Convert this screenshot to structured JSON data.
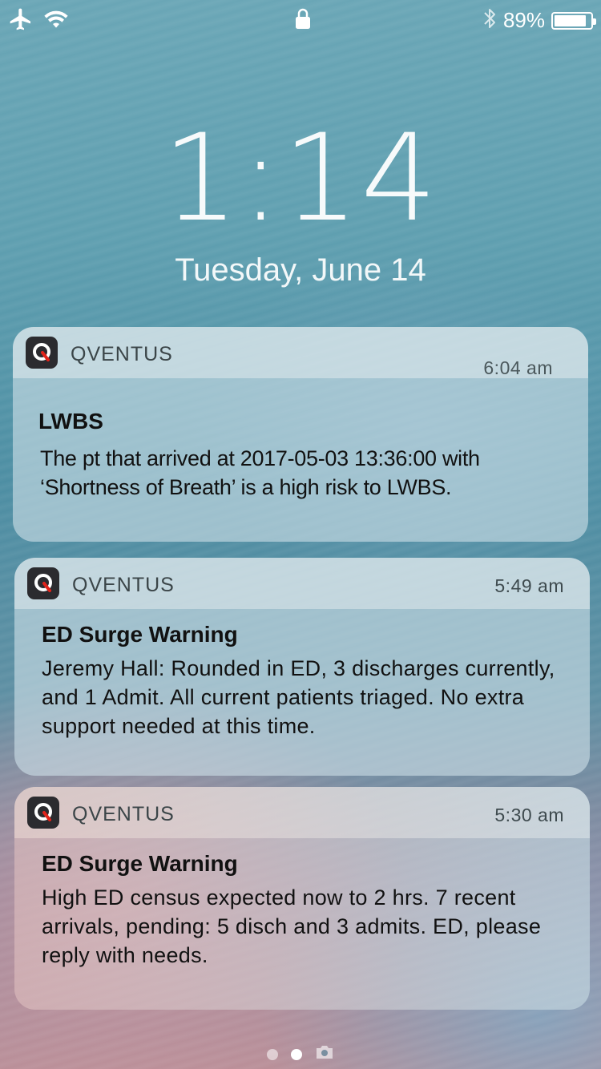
{
  "status_bar": {
    "left_icons": [
      "airplane-icon",
      "wifi-icon"
    ],
    "center_icon": "lock-icon",
    "right_icons": [
      "bluetooth-icon",
      "battery-icon"
    ],
    "battery_percent_text": "89%",
    "battery_level": 0.89
  },
  "lock_screen": {
    "time": "1:14",
    "date": "Tuesday, June 14"
  },
  "notifications": [
    {
      "app_name": "QVENTUS",
      "time": "6:04 am",
      "title": "LWBS",
      "message": "The pt that arrived at 2017-05-03 13:36:00 with ‘Shortness of Breath’ is a high risk to LWBS."
    },
    {
      "app_name": "QVENTUS",
      "time": "5:49 am",
      "title": "ED Surge Warning",
      "message": "Jeremy Hall: Rounded in ED, 3 discharges currently, and 1 Admit. All current patients triaged. No extra support needed at this time."
    },
    {
      "app_name": "QVENTUS",
      "time": "5:30 am",
      "title": "ED Surge Warning",
      "message": "High ED census expected now to 2 hrs. 7 recent arrivals, pending: 5 disch and 3 admits. ED, please reply with needs."
    }
  ],
  "page_indicator": {
    "items": [
      "dot",
      "dot-active",
      "camera-icon"
    ],
    "active_index": 1
  },
  "colors": {
    "app_icon_bg": "#2b2b2f",
    "app_icon_accent": "#e2231a"
  }
}
